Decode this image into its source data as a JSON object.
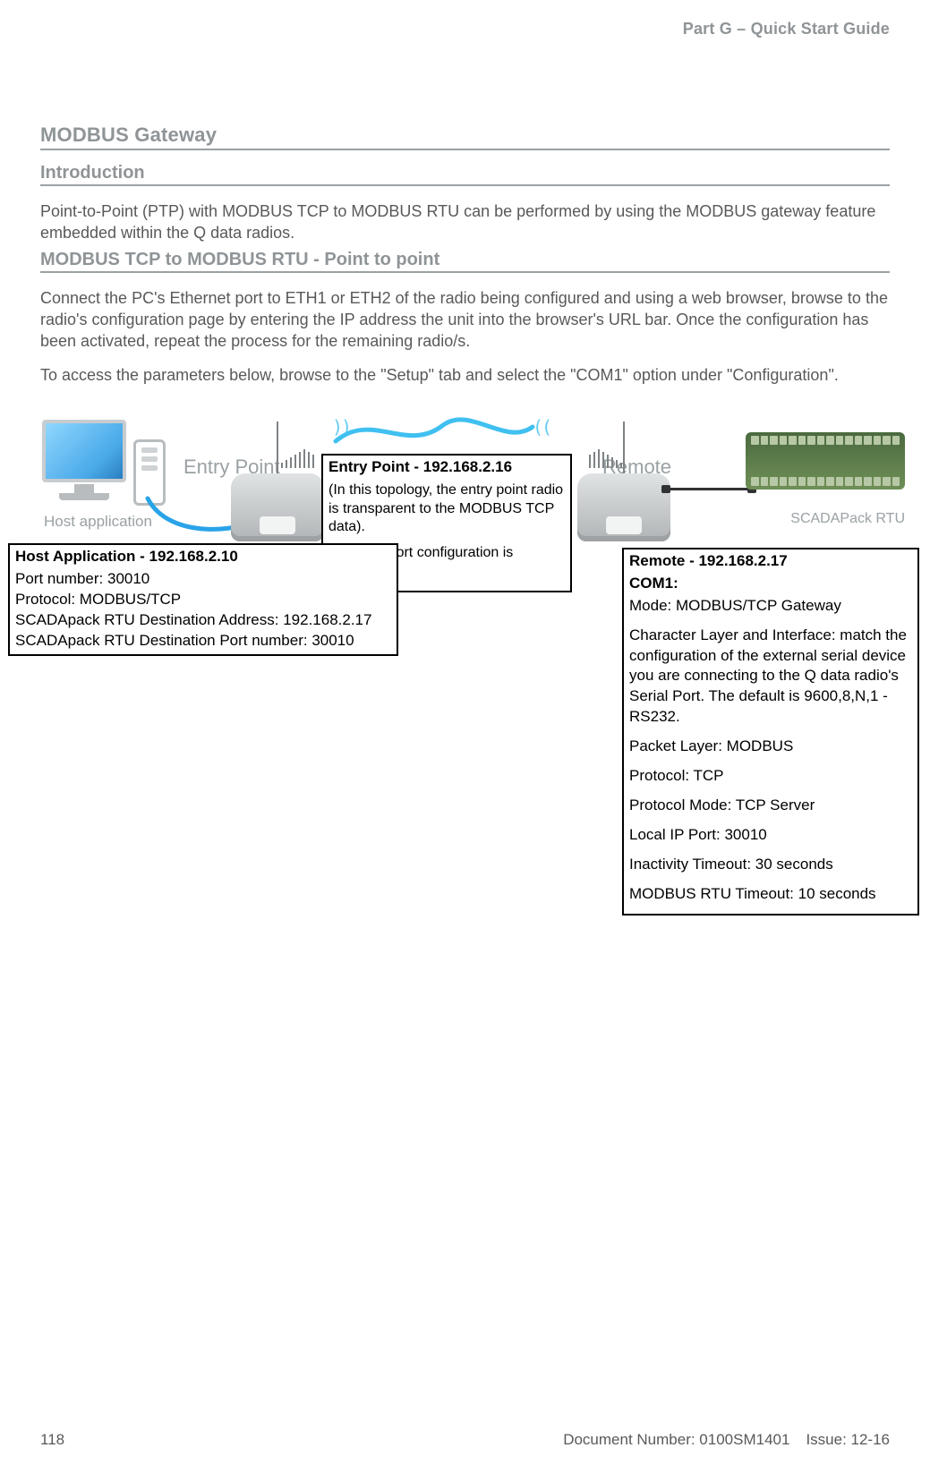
{
  "header": {
    "running_title": "Part G – Quick Start Guide"
  },
  "headings": {
    "section": "MODBUS Gateway",
    "sub_intro": "Introduction",
    "sub_ptp": "MODBUS TCP to MODBUS RTU - Point to point"
  },
  "paragraphs": {
    "intro": "Point-to-Point (PTP) with MODBUS TCP to MODBUS RTU can be performed by using the MODBUS gateway feature embedded within the Q data radios.",
    "connect": "Connect the PC's Ethernet port to ETH1 or ETH2 of the radio being configured and using a web browser, browse to the radio's configuration page by entering the IP address the unit into the browser's URL bar.  Once the configuration has been activated, repeat the process for the remaining radio/s.",
    "access": "To access the parameters below, browse to the \"Setup\" tab and select the \"COM1\" option under \"Configuration\"."
  },
  "diagram": {
    "host_caption": "Host application",
    "entry_label": "Entry Point",
    "remote_label": "Remote",
    "rtu_caption": "SCADAPack RTU"
  },
  "callouts": {
    "entry": {
      "title": "Entry Point - 192.168.2.16",
      "line1": "(In this topology, the entry point radio is transparent to the MODBUS TCP data).",
      "line2": "No COM port configuration is required."
    },
    "host": {
      "title": "Host Application - 192.168.2.10",
      "l1": "Port number: 30010",
      "l2": "Protocol: MODBUS/TCP",
      "l3": "SCADApack RTU Destination Address: 192.168.2.17",
      "l4": "SCADApack RTU Destination Port number: 30010"
    },
    "remote": {
      "title": "Remote - 192.168.2.17",
      "com1": "COM1:",
      "l1": "Mode: MODBUS/TCP Gateway",
      "l2": "Character Layer and Interface: match the configuration of the external serial device you are connecting to the Q data radio's Serial Port. The default is 9600,8,N,1 - RS232.",
      "l3": "Packet Layer: MODBUS",
      "l4": "Protocol: TCP",
      "l5": "Protocol Mode: TCP Server",
      "l6": "Local IP Port: 30010",
      "l7": "Inactivity Timeout: 30 seconds",
      "l8": "MODBUS RTU Timeout: 10 seconds"
    }
  },
  "footer": {
    "page": "118",
    "docnum": "Document Number: 0100SM1401",
    "issue": "Issue: 12-16"
  }
}
